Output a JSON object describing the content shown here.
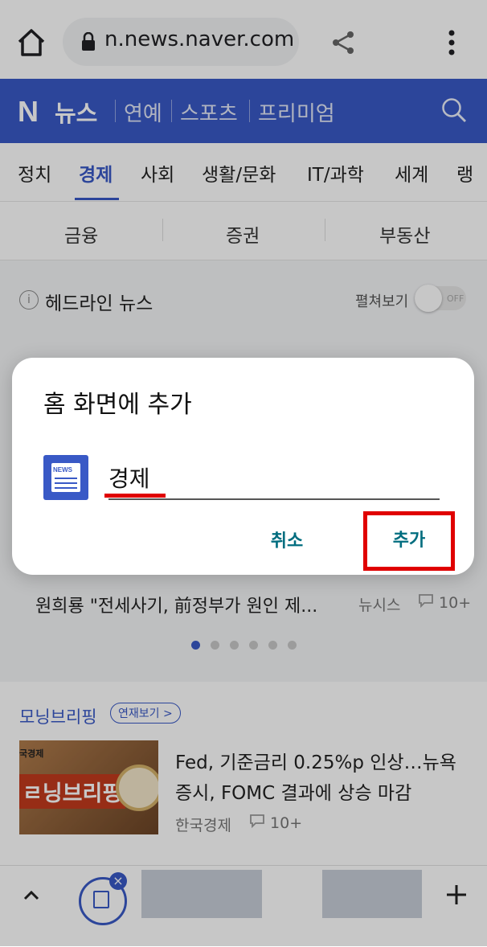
{
  "browser": {
    "url": "n.news.naver.com"
  },
  "header": {
    "logo": "N",
    "title": "뉴스",
    "links": [
      "연예",
      "스포츠",
      "프리미엄"
    ]
  },
  "categories": {
    "tabs": [
      "정치",
      "경제",
      "사회",
      "생활/문화",
      "IT/과학",
      "세계",
      "랭"
    ],
    "active": "경제"
  },
  "subtabs": [
    "금융",
    "증권",
    "부동산"
  ],
  "headline": {
    "title": "헤드라인 뉴스",
    "expand_label": "펼쳐보기",
    "toggle_state": "OFF"
  },
  "news_list": {
    "row1_title": "원희룡 \"전세사기, 前정부가 원인 제...",
    "row1_press": "뉴시스",
    "row1_comments": "10+",
    "carousel_pages": 6,
    "carousel_active": 0
  },
  "briefing": {
    "title": "모닝브리핑",
    "badge": "연재보기 >",
    "thumb_label_small": "국경제",
    "thumb_label": "ㄹ닝브리핑",
    "headline": "Fed, 기준금리 0.25%p 인상…뉴욕증시, FOMC 결과에 상승 마감",
    "press": "한국경제",
    "comments": "10+"
  },
  "dialog": {
    "title": "홈 화면에 추가",
    "icon_text": "NEWS",
    "input_value": "경제",
    "cancel_label": "취소",
    "add_label": "추가"
  },
  "colors": {
    "naver_blue": "#3959c6",
    "dialog_action": "#006d7f",
    "annotation_red": "#e00000"
  }
}
